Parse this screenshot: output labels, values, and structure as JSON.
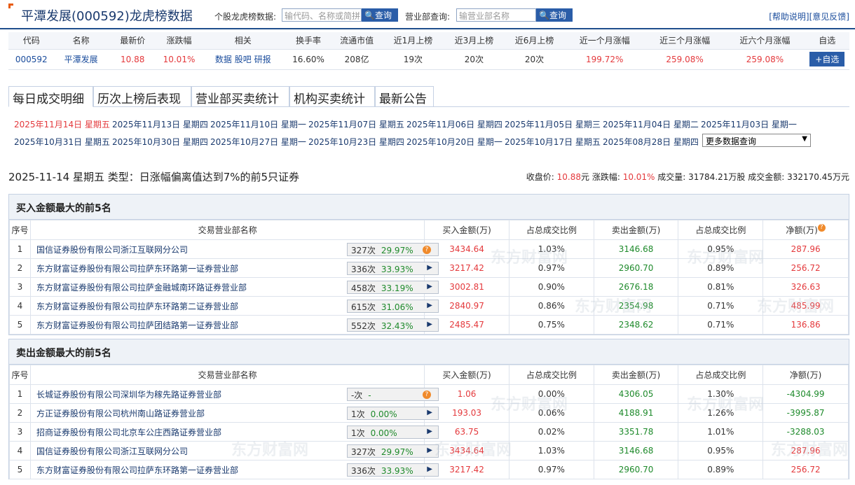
{
  "header": {
    "title": "平潭发展(000592)龙虎榜数据",
    "stock_lookup_label": "个股龙虎榜数据:",
    "stock_lookup_placeholder": "输代码、名称或简拼",
    "query_btn": "查询",
    "branch_lookup_label": "营业部查询:",
    "branch_lookup_placeholder": "输营业部名称",
    "help_link": "[帮助说明]",
    "feedback_link": "[意见反馈]"
  },
  "quote": {
    "headers": [
      "代码",
      "名称",
      "最新价",
      "涨跌幅",
      "相关",
      "换手率",
      "流通市值",
      "近1月上榜",
      "近3月上榜",
      "近6月上榜",
      "近一个月涨幅",
      "近三个月涨幅",
      "近六个月涨幅",
      "自选"
    ],
    "code": "000592",
    "name": "平潭发展",
    "price": "10.88",
    "change": "10.01%",
    "related": [
      "数据",
      "股吧",
      "研报"
    ],
    "turnover": "16.60%",
    "market_cap": "208亿",
    "m1": "19次",
    "m3": "20次",
    "m6": "20次",
    "chg1m": "199.72%",
    "chg3m": "259.08%",
    "chg6m": "259.08%",
    "add_btn": "+自选"
  },
  "tabs": [
    "每日成交明细",
    "历次上榜后表现",
    "营业部买卖统计",
    "机构买卖统计",
    "最新公告"
  ],
  "dates_row1": [
    "2025年11月14日 星期五",
    "2025年11月13日 星期四",
    "2025年11月10日 星期一",
    "2025年11月07日 星期五",
    "2025年11月06日 星期四",
    "2025年11月05日 星期三",
    "2025年11月04日 星期二",
    "2025年11月03日 星期一"
  ],
  "dates_row2": [
    "2025年10月31日 星期五",
    "2025年10月30日 星期四",
    "2025年10月27日 星期一",
    "2025年10月23日 星期四",
    "2025年10月20日 星期一",
    "2025年10月17日 星期五",
    "2025年08月28日 星期四"
  ],
  "more_select": "更多数据查询",
  "summary": {
    "left": "2025-11-14 星期五 类型：日涨幅偏离值达到7%的前5只证券",
    "close_label": "收盘价:",
    "close_val": "10.88",
    "close_unit": "元",
    "chg_label": "涨跌幅:",
    "chg_val": "10.01%",
    "vol_text": "成交量: 31784.21万股",
    "amt_text": "成交金额: 332170.45万元"
  },
  "table_headers": [
    "序号",
    "交易营业部名称",
    "买入金额(万)",
    "占总成交比例",
    "卖出金额(万)",
    "占总成交比例",
    "净额(万)"
  ],
  "buy": {
    "title": "买入金额最大的前5名",
    "rows": [
      {
        "no": "1",
        "name": "国信证券股份有限公司浙江互联网分公司",
        "times": "327次",
        "pct": "29.97%",
        "buy": "3434.64",
        "bp": "1.03%",
        "sell": "3146.68",
        "sp": "0.95%",
        "net": "287.96",
        "icon": "q"
      },
      {
        "no": "2",
        "name": "东方财富证券股份有限公司拉萨东环路第一证券营业部",
        "times": "336次",
        "pct": "33.93%",
        "buy": "3217.42",
        "bp": "0.97%",
        "sell": "2960.70",
        "sp": "0.89%",
        "net": "256.72",
        "icon": "play"
      },
      {
        "no": "3",
        "name": "东方财富证券股份有限公司拉萨金融城南环路证券营业部",
        "times": "458次",
        "pct": "33.19%",
        "buy": "3002.81",
        "bp": "0.90%",
        "sell": "2676.18",
        "sp": "0.81%",
        "net": "326.63",
        "icon": "play"
      },
      {
        "no": "4",
        "name": "东方财富证券股份有限公司拉萨东环路第二证券营业部",
        "times": "615次",
        "pct": "31.06%",
        "buy": "2840.97",
        "bp": "0.86%",
        "sell": "2354.98",
        "sp": "0.71%",
        "net": "485.99",
        "icon": "play"
      },
      {
        "no": "5",
        "name": "东方财富证券股份有限公司拉萨团结路第一证券营业部",
        "times": "552次",
        "pct": "32.43%",
        "buy": "2485.47",
        "bp": "0.75%",
        "sell": "2348.62",
        "sp": "0.71%",
        "net": "136.86",
        "icon": "play"
      }
    ]
  },
  "sell": {
    "title": "卖出金额最大的前5名",
    "rows": [
      {
        "no": "1",
        "name": "长城证券股份有限公司深圳华为稼先路证券营业部",
        "times": "-次",
        "pct": "-",
        "buy": "1.06",
        "bp": "0.00%",
        "sell": "4306.05",
        "sp": "1.30%",
        "net": "-4304.99",
        "icon": "q"
      },
      {
        "no": "2",
        "name": "方正证券股份有限公司杭州南山路证券营业部",
        "times": "1次",
        "pct": "0.00%",
        "buy": "193.03",
        "bp": "0.06%",
        "sell": "4188.91",
        "sp": "1.26%",
        "net": "-3995.87",
        "icon": "play"
      },
      {
        "no": "3",
        "name": "招商证券股份有限公司北京车公庄西路证券营业部",
        "times": "1次",
        "pct": "0.00%",
        "buy": "63.75",
        "bp": "0.02%",
        "sell": "3351.78",
        "sp": "1.01%",
        "net": "-3288.03",
        "icon": "play"
      },
      {
        "no": "4",
        "name": "国信证券股份有限公司浙江互联网分公司",
        "times": "327次",
        "pct": "29.97%",
        "buy": "3434.64",
        "bp": "1.03%",
        "sell": "3146.68",
        "sp": "0.95%",
        "net": "287.96",
        "icon": "play"
      },
      {
        "no": "5",
        "name": "东方财富证券股份有限公司拉萨东环路第一证券营业部",
        "times": "336次",
        "pct": "33.93%",
        "buy": "3217.42",
        "bp": "0.97%",
        "sell": "2960.70",
        "sp": "0.89%",
        "net": "256.72",
        "icon": "play"
      }
    ]
  },
  "watermark": "东方财富网",
  "icons": {
    "help": "?",
    "play": "▶",
    "dropdown": "▼"
  },
  "colors": {
    "up": "#e4393c",
    "down": "#1e8a2b",
    "accent": "#2a5da8"
  }
}
